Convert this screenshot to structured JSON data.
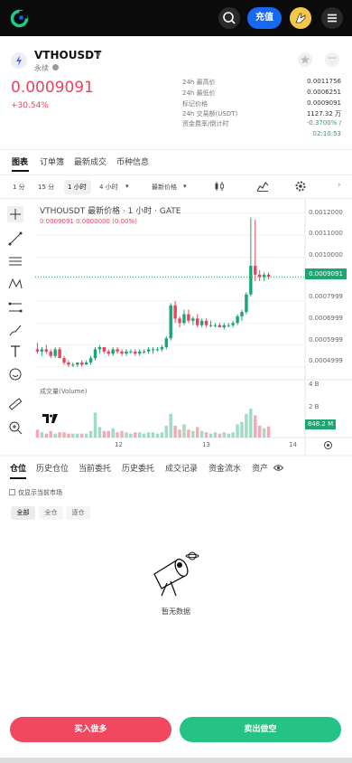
{
  "header": {
    "deposit_label": "充值",
    "icons": [
      "logo-icon",
      "search-icon",
      "avatar-icon",
      "menu-icon"
    ],
    "accent_color": "#1768f5"
  },
  "ticker": {
    "symbol": "VTHOUSDT",
    "type": "永续",
    "last_price": "0.0009091",
    "change_pct": "+30.54%",
    "up_color": "#e5465e",
    "down_color": "#1ba672",
    "stats": [
      {
        "label": "24h 最高价",
        "value": "0.0011756"
      },
      {
        "label": "24h 最低价",
        "value": "0.0006251"
      },
      {
        "label": "标记价格",
        "value": "0.0009091"
      },
      {
        "label": "24h 交易额(USDT)",
        "value": "1127.32 万"
      },
      {
        "label": "资金费率/倒计时",
        "value": "-0.3700% /"
      },
      {
        "label": "",
        "value": "02:10:53"
      }
    ]
  },
  "tabs": [
    "图表",
    "订单簿",
    "最新成交",
    "币种信息"
  ],
  "toolbar": {
    "intervals": [
      "1 分",
      "15 分",
      "1 小时",
      "4 小时"
    ],
    "selected": "1 小时",
    "price_type": "最新价格"
  },
  "chart_data": {
    "type": "candlestick",
    "title": "VTHOUSDT 最新价格 · 1 小时 · GATE",
    "ohlc_readout": "0.0009091  0.0000000 (0.00%)",
    "volume_label": "成交量(Volume)",
    "y_ticks": [
      "0.0012000",
      "0.0011000",
      "0.0010000",
      "0.0009091",
      "0.0007999",
      "0.0006999",
      "0.0005999",
      "0.0004999"
    ],
    "y_range": [
      0.00045,
      0.00124
    ],
    "x_ticks": [
      "12",
      "13",
      "14"
    ],
    "volume_ticks": [
      "4 B",
      "2 B"
    ],
    "volume_last": "848.2 M",
    "last_price": 0.0009091,
    "candles": [
      {
        "o": 0.00058,
        "h": 0.00061,
        "l": 0.00056,
        "c": 0.00057
      },
      {
        "o": 0.00057,
        "h": 0.00059,
        "l": 0.00055,
        "c": 0.00058
      },
      {
        "o": 0.00058,
        "h": 0.0006,
        "l": 0.00056,
        "c": 0.00057
      },
      {
        "o": 0.00057,
        "h": 0.00058,
        "l": 0.00054,
        "c": 0.00055
      },
      {
        "o": 0.00055,
        "h": 0.00059,
        "l": 0.00054,
        "c": 0.00058
      },
      {
        "o": 0.00058,
        "h": 0.00059,
        "l": 0.00054,
        "c": 0.00054
      },
      {
        "o": 0.00054,
        "h": 0.00055,
        "l": 0.00051,
        "c": 0.00052
      },
      {
        "o": 0.00052,
        "h": 0.00053,
        "l": 0.0005,
        "c": 0.00051
      },
      {
        "o": 0.00051,
        "h": 0.00052,
        "l": 0.0005,
        "c": 0.00051
      },
      {
        "o": 0.00051,
        "h": 0.00052,
        "l": 0.0005,
        "c": 0.00052
      },
      {
        "o": 0.00052,
        "h": 0.00053,
        "l": 0.0005,
        "c": 0.00051
      },
      {
        "o": 0.00051,
        "h": 0.00053,
        "l": 0.00051,
        "c": 0.00052
      },
      {
        "o": 0.00052,
        "h": 0.00055,
        "l": 0.00051,
        "c": 0.00054
      },
      {
        "o": 0.00054,
        "h": 0.00059,
        "l": 0.00053,
        "c": 0.00058
      },
      {
        "o": 0.00058,
        "h": 0.0006,
        "l": 0.00056,
        "c": 0.00059
      },
      {
        "o": 0.00059,
        "h": 0.00059,
        "l": 0.00056,
        "c": 0.00057
      },
      {
        "o": 0.00057,
        "h": 0.00058,
        "l": 0.00055,
        "c": 0.00056
      },
      {
        "o": 0.00056,
        "h": 0.00059,
        "l": 0.00055,
        "c": 0.00058
      },
      {
        "o": 0.00058,
        "h": 0.00059,
        "l": 0.00056,
        "c": 0.00057
      },
      {
        "o": 0.00057,
        "h": 0.00058,
        "l": 0.00055,
        "c": 0.00056
      },
      {
        "o": 0.00056,
        "h": 0.00058,
        "l": 0.00055,
        "c": 0.00057
      },
      {
        "o": 0.00057,
        "h": 0.00058,
        "l": 0.00056,
        "c": 0.00057
      },
      {
        "o": 0.00057,
        "h": 0.00058,
        "l": 0.00055,
        "c": 0.00056
      },
      {
        "o": 0.00056,
        "h": 0.00058,
        "l": 0.00055,
        "c": 0.00057
      },
      {
        "o": 0.00057,
        "h": 0.00058,
        "l": 0.00056,
        "c": 0.00057
      },
      {
        "o": 0.00057,
        "h": 0.00059,
        "l": 0.00056,
        "c": 0.00058
      },
      {
        "o": 0.00058,
        "h": 0.00059,
        "l": 0.00056,
        "c": 0.00058
      },
      {
        "o": 0.00058,
        "h": 0.00059,
        "l": 0.00057,
        "c": 0.00058
      },
      {
        "o": 0.00058,
        "h": 0.0006,
        "l": 0.00057,
        "c": 0.00059
      },
      {
        "o": 0.00059,
        "h": 0.00064,
        "l": 0.00058,
        "c": 0.00063
      },
      {
        "o": 0.00063,
        "h": 0.00079,
        "l": 0.00062,
        "c": 0.00078
      },
      {
        "o": 0.00078,
        "h": 0.0008,
        "l": 0.0007,
        "c": 0.00072
      },
      {
        "o": 0.00072,
        "h": 0.00073,
        "l": 0.00068,
        "c": 0.0007
      },
      {
        "o": 0.0007,
        "h": 0.00076,
        "l": 0.00069,
        "c": 0.00074
      },
      {
        "o": 0.00074,
        "h": 0.00076,
        "l": 0.0007,
        "c": 0.00071
      },
      {
        "o": 0.00071,
        "h": 0.00073,
        "l": 0.00069,
        "c": 0.00072
      },
      {
        "o": 0.00072,
        "h": 0.00074,
        "l": 0.00068,
        "c": 0.00069
      },
      {
        "o": 0.00069,
        "h": 0.00072,
        "l": 0.00068,
        "c": 0.00071
      },
      {
        "o": 0.00071,
        "h": 0.00072,
        "l": 0.00068,
        "c": 0.00069
      },
      {
        "o": 0.00069,
        "h": 0.00071,
        "l": 0.00068,
        "c": 0.00069
      },
      {
        "o": 0.00069,
        "h": 0.0007,
        "l": 0.00068,
        "c": 0.00069
      },
      {
        "o": 0.00069,
        "h": 0.0007,
        "l": 0.00068,
        "c": 0.00068
      },
      {
        "o": 0.00068,
        "h": 0.0007,
        "l": 0.00067,
        "c": 0.00069
      },
      {
        "o": 0.00069,
        "h": 0.0007,
        "l": 0.00068,
        "c": 0.00069
      },
      {
        "o": 0.00069,
        "h": 0.00071,
        "l": 0.00068,
        "c": 0.0007
      },
      {
        "o": 0.0007,
        "h": 0.00074,
        "l": 0.00069,
        "c": 0.00073
      },
      {
        "o": 0.00073,
        "h": 0.00076,
        "l": 0.00071,
        "c": 0.00075
      },
      {
        "o": 0.00075,
        "h": 0.00084,
        "l": 0.00074,
        "c": 0.00083
      },
      {
        "o": 0.00083,
        "h": 0.00118,
        "l": 0.00082,
        "c": 0.00096
      },
      {
        "o": 0.00096,
        "h": 0.00117,
        "l": 0.00089,
        "c": 0.00092
      },
      {
        "o": 0.00092,
        "h": 0.00094,
        "l": 0.00089,
        "c": 0.00091
      },
      {
        "o": 0.00091,
        "h": 0.00093,
        "l": 0.00089,
        "c": 0.00092
      },
      {
        "o": 0.00092,
        "h": 0.00093,
        "l": 0.0009,
        "c": 0.00091
      }
    ],
    "volumes": [
      0.6,
      0.4,
      0.3,
      0.5,
      0.3,
      0.4,
      0.4,
      0.3,
      0.3,
      0.3,
      0.3,
      0.3,
      0.5,
      1.9,
      0.8,
      0.5,
      0.5,
      0.7,
      0.4,
      0.5,
      0.4,
      0.3,
      0.4,
      0.4,
      0.3,
      0.4,
      0.4,
      0.3,
      0.4,
      0.9,
      1.8,
      0.9,
      0.6,
      1.0,
      0.6,
      0.5,
      0.8,
      0.5,
      0.4,
      0.3,
      0.4,
      0.3,
      0.4,
      0.3,
      0.4,
      1.0,
      1.2,
      1.8,
      2.2,
      1.7,
      0.9,
      0.7,
      0.85
    ]
  },
  "bottom_tabs": [
    "仓位",
    "历史仓位",
    "当前委托",
    "历史委托",
    "成交记录",
    "资金流水",
    "资产"
  ],
  "filter": {
    "checkbox_label": "仅显示当前市场",
    "segments": [
      "全部",
      "全仓",
      "逐仓"
    ]
  },
  "empty_text": "暂无数据",
  "actions": {
    "buy_label": "买入做多",
    "sell_label": "卖出做空"
  }
}
